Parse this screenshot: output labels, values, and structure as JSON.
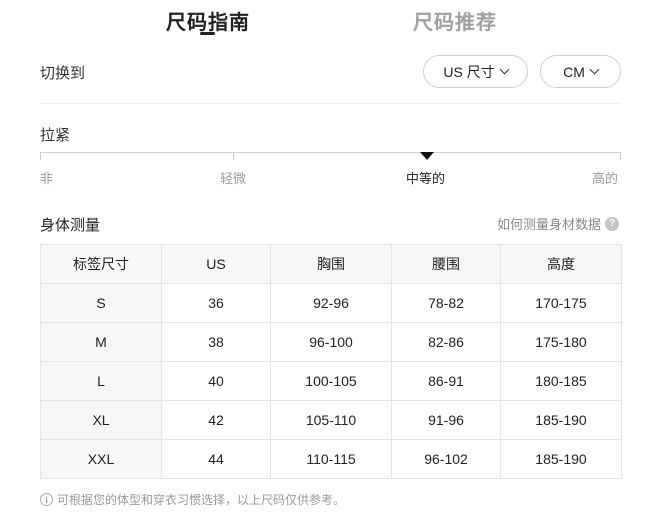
{
  "tabs": [
    {
      "label": "尺码指南",
      "active": true
    },
    {
      "label": "尺码推荐",
      "active": false
    }
  ],
  "switch": {
    "label": "切换到",
    "region_label": "US 尺寸",
    "unit_label": "CM"
  },
  "fit": {
    "title": "拉紧",
    "levels": [
      "非",
      "轻微",
      "中等的",
      "高的"
    ],
    "selected_index": 2
  },
  "measurements": {
    "title": "身体测量",
    "help_label": "如何测量身材数据",
    "headers": [
      "标签尺寸",
      "US",
      "胸围",
      "腰围",
      "高度"
    ],
    "rows": [
      [
        "S",
        "36",
        "92-96",
        "78-82",
        "170-175"
      ],
      [
        "M",
        "38",
        "96-100",
        "82-86",
        "175-180"
      ],
      [
        "L",
        "40",
        "100-105",
        "86-91",
        "180-185"
      ],
      [
        "XL",
        "42",
        "105-110",
        "91-96",
        "185-190"
      ],
      [
        "XXL",
        "44",
        "110-115",
        "96-102",
        "185-190"
      ]
    ]
  },
  "footer": {
    "note": "可根据您的体型和穿衣习惯选择，以上尺码仅供参考。"
  },
  "colors": {
    "text": "#222222",
    "muted": "#9a9a9a",
    "border": "#e4e4e4",
    "header_bg": "#f7f7f7"
  }
}
